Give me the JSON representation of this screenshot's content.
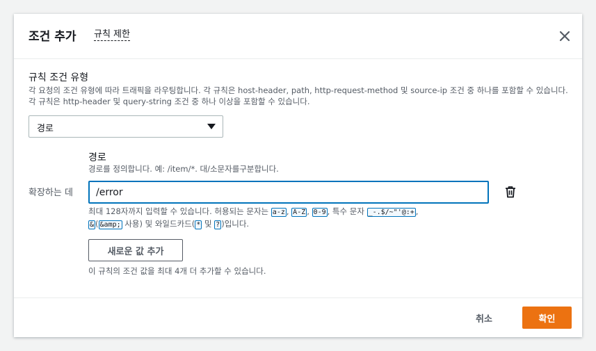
{
  "dialog": {
    "title": "조건 추가",
    "info_link": "규칙 제한"
  },
  "condition_type": {
    "label": "규칙 조건 유형",
    "description": "각 요청의 조건 유형에 따라 트래픽을 라우팅합니다. 각 규칙은 host-header, path, http-request-method 및 source-ip 조건 중 하나를 포함할 수 있습니다. 각 규칙은 http-header 및 query-string 조건 중 하나 이상을 포함할 수 있습니다.",
    "selected": "경로"
  },
  "path": {
    "label": "경로",
    "description": "경로를 정의합니다. 예: /item/*. 대/소문자를구분합니다.",
    "row_label": "확장하는 데",
    "value": "/error",
    "hint_1": "최대 128자까지 입력할 수 있습니다. 허용되는 문자는 ",
    "code_az": "a-z",
    "sep_1": ", ",
    "code_AZ": "A-Z",
    "sep_2": ", ",
    "code_09": "0-9",
    "hint_2": ", 특수 문자 ",
    "code_special": "_-.$/~\"'@:+",
    "sep_3": ",",
    "code_amp": "&",
    "hint_3": "(",
    "code_amp_ent": "&amp;",
    "hint_4": " 사용) 및 와일드카드(",
    "code_star": "*",
    "hint_5": " 및 ",
    "code_q": "?",
    "hint_6": ")입니다."
  },
  "add_value": {
    "button": "새로운 값 추가",
    "hint": "이 규칙의 조건 값을 최대 4개 더 추가할 수 있습니다."
  },
  "footer": {
    "cancel": "취소",
    "confirm": "확인"
  },
  "colors": {
    "accent": "#ec7211",
    "focus": "#0073bb"
  },
  "icons": {
    "close": "close-icon",
    "caret": "caret-down-icon",
    "trash": "trash-icon"
  }
}
